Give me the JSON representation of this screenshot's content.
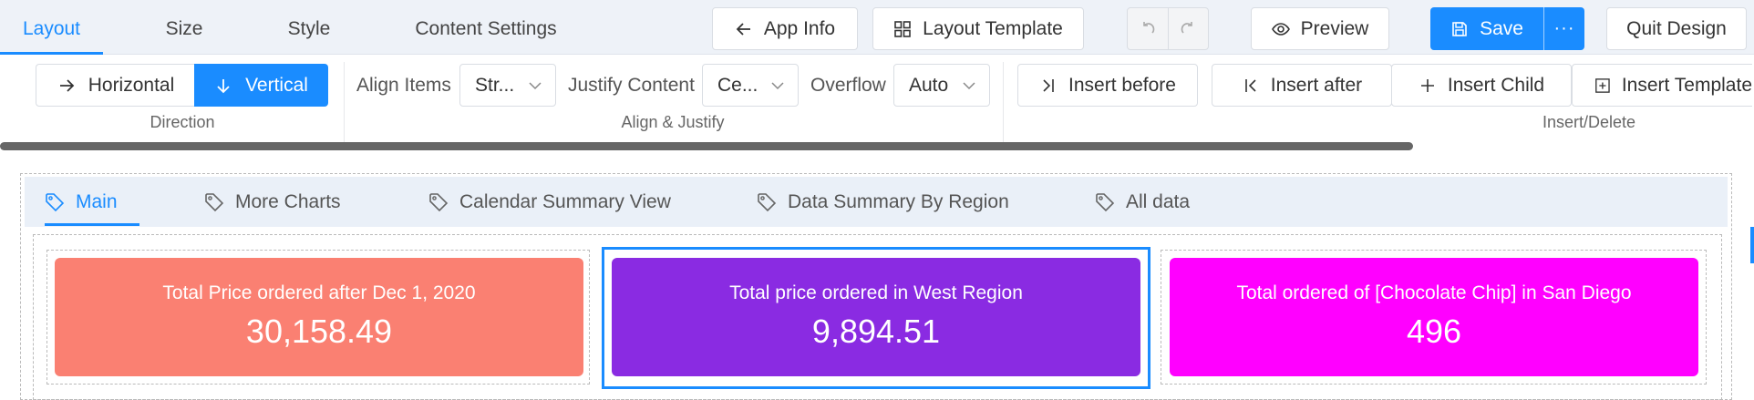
{
  "topbar": {
    "tabs": [
      {
        "label": "Layout",
        "active": true
      },
      {
        "label": "Size",
        "active": false
      },
      {
        "label": "Style",
        "active": false
      },
      {
        "label": "Content Settings",
        "active": false
      }
    ],
    "app_info": "App Info",
    "layout_template": "Layout Template",
    "preview": "Preview",
    "save": "Save",
    "more": "···",
    "quit": "Quit Design"
  },
  "ribbon": {
    "direction": {
      "horizontal": "Horizontal",
      "vertical": "Vertical",
      "selected": "Vertical",
      "group_label": "Direction"
    },
    "align": {
      "align_items_label": "Align Items",
      "align_items_value": "Str...",
      "justify_label": "Justify Content",
      "justify_value": "Ce...",
      "overflow_label": "Overflow",
      "overflow_value": "Auto",
      "group_label": "Align & Justify"
    },
    "insert": {
      "before": "Insert before",
      "after": "Insert after",
      "child": "Insert Child",
      "template": "Insert Template",
      "group_label": "Insert/Delete"
    }
  },
  "canvas": {
    "tabs": [
      {
        "label": "Main",
        "active": true
      },
      {
        "label": "More Charts",
        "active": false
      },
      {
        "label": "Calendar Summary View",
        "active": false
      },
      {
        "label": "Data Summary By Region",
        "active": false
      },
      {
        "label": "All data",
        "active": false
      }
    ],
    "cards": [
      {
        "title": "Total Price ordered after Dec 1, 2020",
        "value": "30,158.49",
        "color": "#fa8072",
        "selected": false
      },
      {
        "title": "Total price ordered in West Region",
        "value": "9,894.51",
        "color": "#8a2be2",
        "selected": true
      },
      {
        "title": "Total ordered of [Chocolate Chip] in San Diego",
        "value": "496",
        "color": "#ff00ff",
        "selected": false
      }
    ]
  },
  "colors": {
    "accent": "#1a8cff"
  }
}
